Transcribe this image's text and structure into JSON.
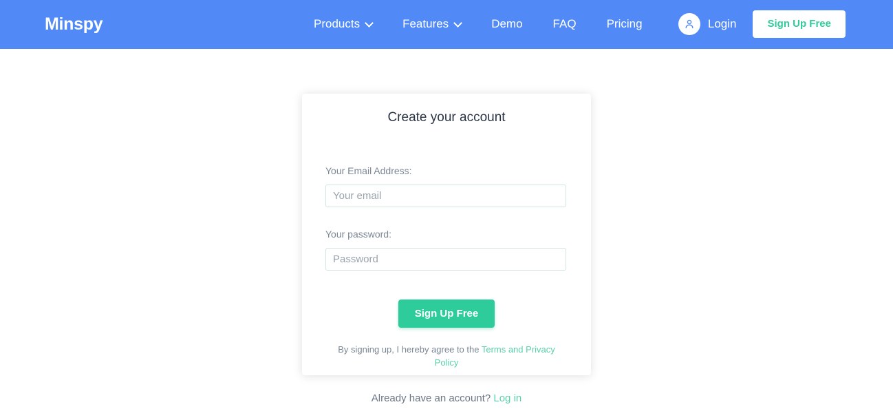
{
  "header": {
    "logo": "Minspy",
    "nav": [
      {
        "label": "Products",
        "has_chevron": true,
        "icon": "chevron-down-icon"
      },
      {
        "label": "Features",
        "has_chevron": true,
        "icon": "chevron-down-icon"
      },
      {
        "label": "Demo",
        "has_chevron": false
      },
      {
        "label": "FAQ",
        "has_chevron": false
      },
      {
        "label": "Pricing",
        "has_chevron": false
      }
    ],
    "avatar_icon": "user-avatar-icon",
    "login_label": "Login",
    "signup_label": "Sign Up Free",
    "colors": {
      "bar_background": "#5189f7",
      "signup_text": "#2ecc9a",
      "signup_background": "#ffffff"
    }
  },
  "card": {
    "title": "Create your account",
    "email": {
      "label": "Your Email Address:",
      "placeholder": "Your email",
      "value": ""
    },
    "password": {
      "label": "Your password:",
      "placeholder": "Password",
      "value": ""
    },
    "submit_label": "Sign Up Free",
    "terms": {
      "text": "By signing up, I hereby agree to the ",
      "link": "Terms and Privacy Policy"
    },
    "colors": {
      "title": "#2b3445",
      "label": "#7b8794",
      "input_border": "#cfe7dd",
      "button": "#2ecc9a",
      "link": "#5ad1a8"
    }
  },
  "footer": {
    "text": "Already have an account? ",
    "link": "Log in"
  }
}
